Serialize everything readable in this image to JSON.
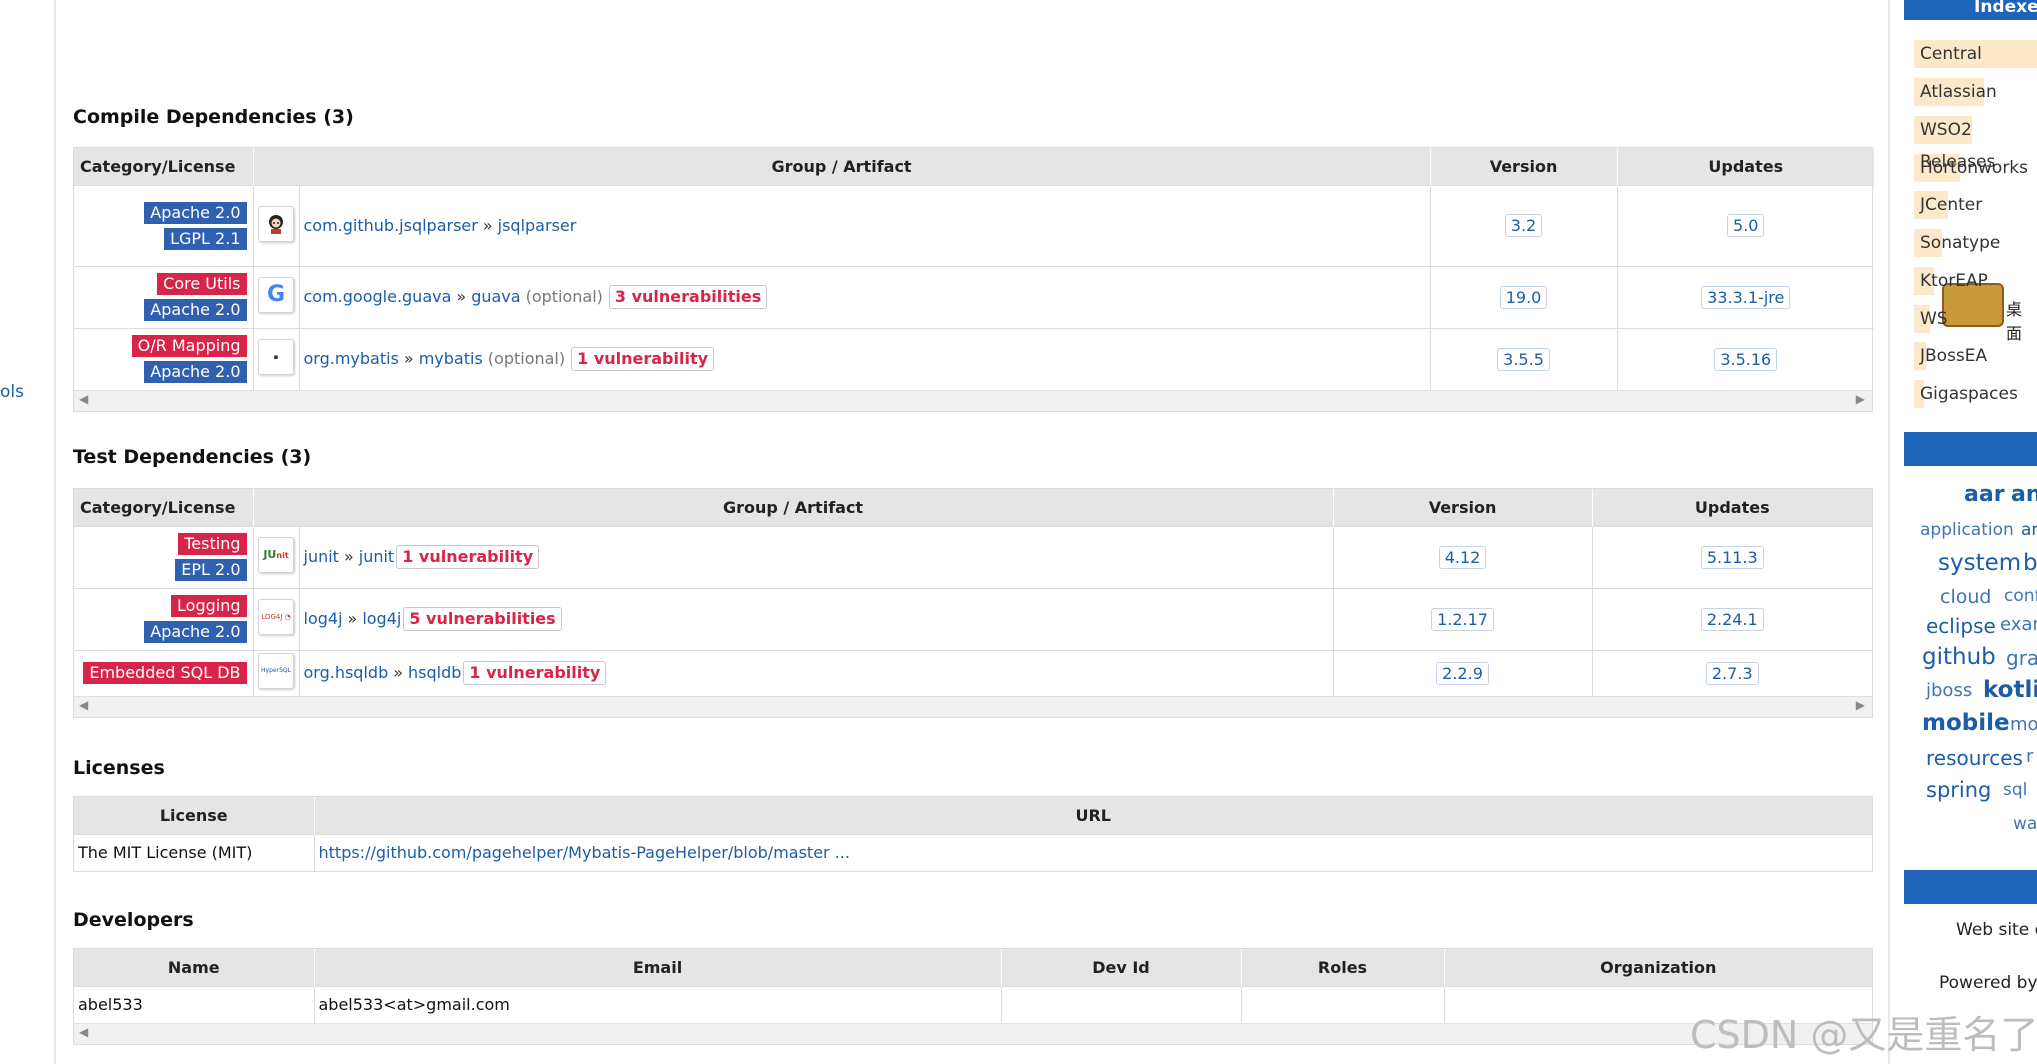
{
  "left_gutter": {
    "cut_link": "ols"
  },
  "compile": {
    "title": "Compile Dependencies (3)",
    "headers": {
      "category": "Category/License",
      "artifact": "Group / Artifact",
      "version": "Version",
      "updates": "Updates"
    },
    "rows": [
      {
        "licenses": [
          {
            "text": "Apache 2.0",
            "color": "#3060b0"
          },
          {
            "text": "LGPL 2.1",
            "color": "#3060b0"
          }
        ],
        "logo": "github-icon",
        "group": "com.github.jsqlparser",
        "artifact": "jsqlparser",
        "optional": "",
        "vulnerabilities": "",
        "version": "3.2",
        "update": "5.0"
      },
      {
        "licenses": [
          {
            "text": "Core Utils",
            "color": "#d9244a"
          },
          {
            "text": "Apache 2.0",
            "color": "#3060b0"
          }
        ],
        "logo": "google-icon",
        "group": "com.google.guava",
        "artifact": "guava",
        "optional": "(optional)",
        "vulnerabilities": "3 vulnerabilities",
        "version": "19.0",
        "update": "33.3.1-jre"
      },
      {
        "licenses": [
          {
            "text": "O/R Mapping",
            "color": "#d9244a"
          },
          {
            "text": "Apache 2.0",
            "color": "#3060b0"
          }
        ],
        "logo": "mybatis-icon",
        "group": "org.mybatis",
        "artifact": "mybatis",
        "optional": "(optional)",
        "vulnerabilities": "1 vulnerability",
        "version": "3.5.5",
        "update": "3.5.16"
      }
    ]
  },
  "test": {
    "title": "Test Dependencies (3)",
    "headers": {
      "category": "Category/License",
      "artifact": "Group / Artifact",
      "version": "Version",
      "updates": "Updates"
    },
    "rows": [
      {
        "licenses": [
          {
            "text": "Testing",
            "color": "#d9244a"
          },
          {
            "text": "EPL 2.0",
            "color": "#3060b0"
          }
        ],
        "logo": "junit-icon",
        "group": "junit",
        "artifact": "junit",
        "vulnerabilities": "1 vulnerability",
        "version": "4.12",
        "update": "5.11.3"
      },
      {
        "licenses": [
          {
            "text": "Logging",
            "color": "#d9244a"
          },
          {
            "text": "Apache 2.0",
            "color": "#3060b0"
          }
        ],
        "logo": "log4j-icon",
        "group": "log4j",
        "artifact": "log4j",
        "vulnerabilities": "5 vulnerabilities",
        "version": "1.2.17",
        "update": "2.24.1"
      },
      {
        "licenses": [
          {
            "text": "Embedded SQL DB",
            "color": "#d9244a"
          }
        ],
        "logo": "hsqldb-icon",
        "group": "org.hsqldb",
        "artifact": "hsqldb",
        "vulnerabilities": "1 vulnerability",
        "version": "2.2.9",
        "update": "2.7.3"
      }
    ]
  },
  "licenses": {
    "title": "Licenses",
    "headers": {
      "license": "License",
      "url": "URL"
    },
    "rows": [
      {
        "license": "The MIT License (MIT)",
        "url": "https://github.com/pagehelper/Mybatis-PageHelper/blob/master ..."
      }
    ]
  },
  "developers": {
    "title": "Developers",
    "headers": {
      "name": "Name",
      "email": "Email",
      "dev_id": "Dev Id",
      "roles": "Roles",
      "organization": "Organization"
    },
    "rows": [
      {
        "name": "abel533",
        "email": "abel533<at>gmail.com",
        "dev_id": "",
        "roles": "",
        "organization": ""
      }
    ]
  },
  "sidebar": {
    "indexed_head": "Indexe",
    "repos": [
      "Central",
      "Atlassian",
      "WSO2 Releases",
      "Hortonworks",
      "JCenter",
      "Sonatype",
      "KtorEAP",
      "WS",
      "JBossEA",
      "Gigaspaces"
    ],
    "tags": [
      "aar",
      "an",
      "application",
      "ar",
      "system",
      "b",
      "cloud",
      "confi",
      "eclipse",
      "exam",
      "github",
      "grad",
      "jboss",
      "kotlin",
      "mobile",
      "mo",
      "resources",
      "r",
      "spring",
      "sql",
      "war"
    ],
    "footer_web": "Web site d",
    "footer_powered": "Powered by:",
    "sticker_label": "桌面"
  },
  "watermark": "CSDN @又是重名了"
}
